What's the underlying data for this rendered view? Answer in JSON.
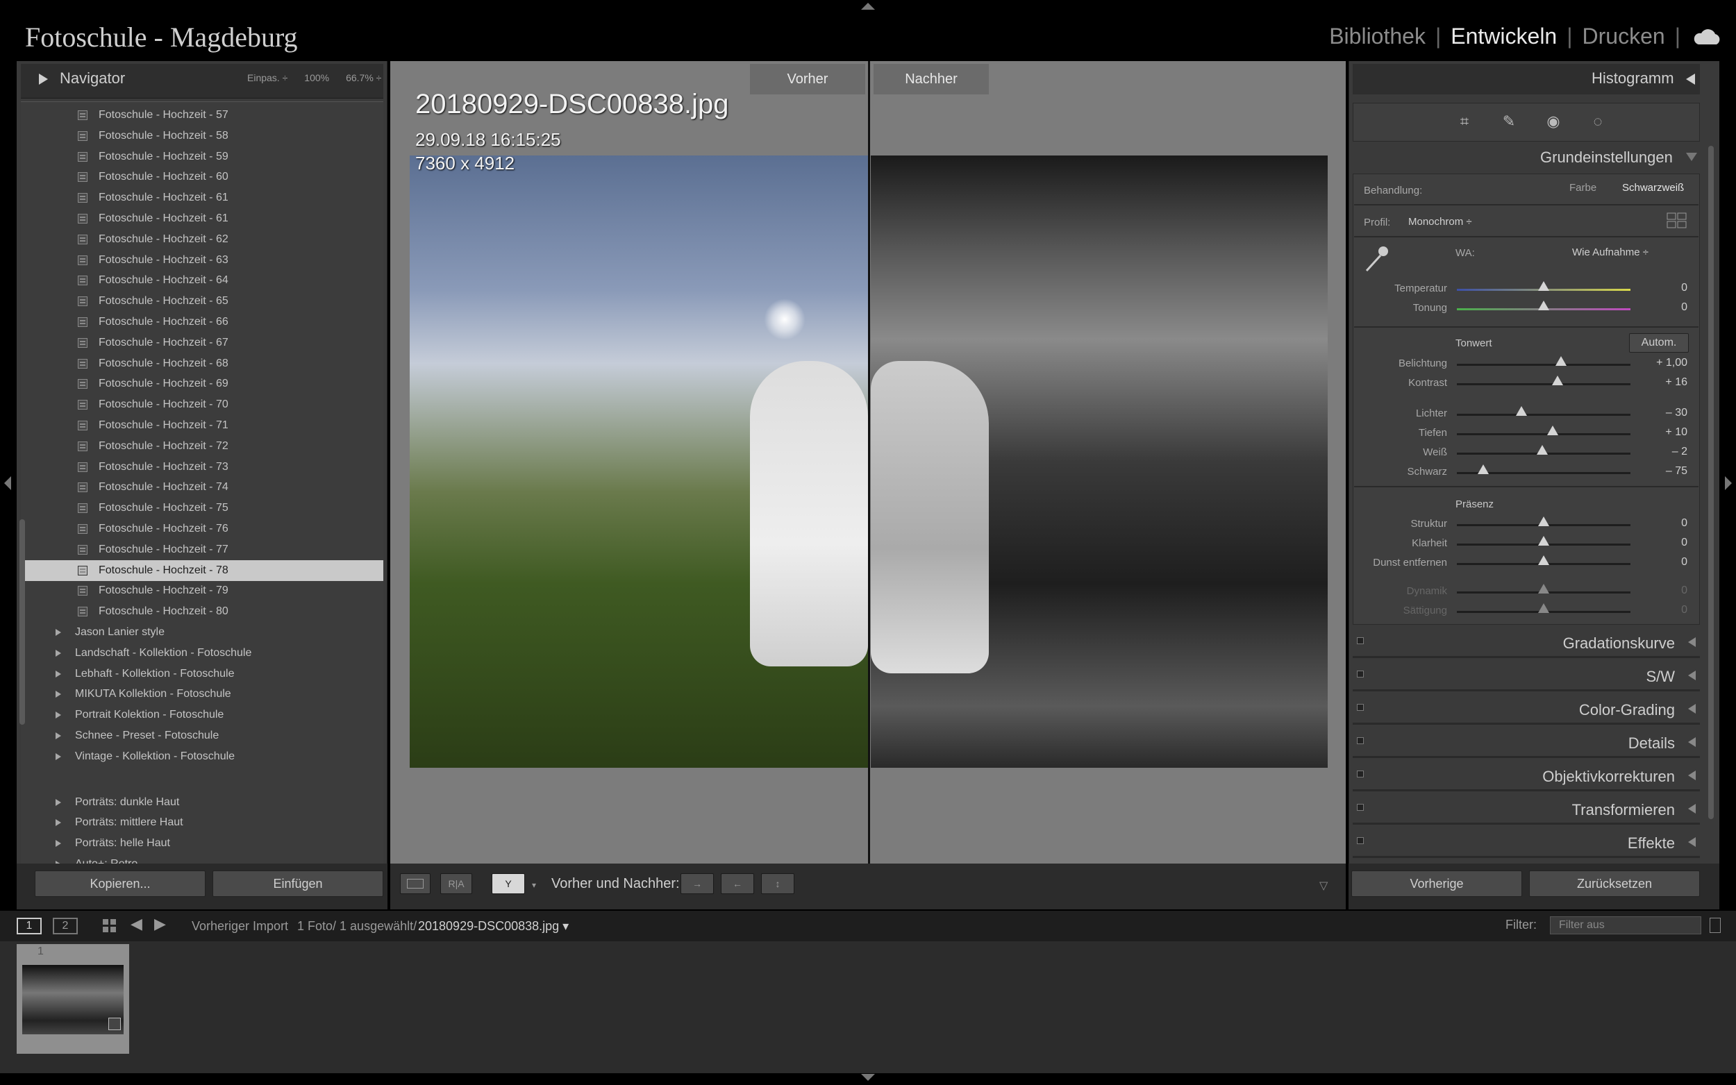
{
  "app": {
    "title": "Fotoschule - Magdeburg"
  },
  "modules": {
    "library": "Bibliothek",
    "develop": "Entwickeln",
    "print": "Drucken",
    "sep": "|"
  },
  "navigator": {
    "title": "Navigator",
    "fit": "Einpas. ÷",
    "zoom100": "100%",
    "zoom667": "66.7% ÷"
  },
  "presets": {
    "items": [
      "Fotoschule - Hochzeit - 57",
      "Fotoschule - Hochzeit - 58",
      "Fotoschule - Hochzeit - 59",
      "Fotoschule - Hochzeit - 60",
      "Fotoschule - Hochzeit - 61",
      "Fotoschule - Hochzeit - 61",
      "Fotoschule - Hochzeit - 62",
      "Fotoschule - Hochzeit - 63",
      "Fotoschule - Hochzeit - 64",
      "Fotoschule - Hochzeit - 65",
      "Fotoschule - Hochzeit - 66",
      "Fotoschule - Hochzeit - 67",
      "Fotoschule - Hochzeit - 68",
      "Fotoschule - Hochzeit - 69",
      "Fotoschule - Hochzeit - 70",
      "Fotoschule - Hochzeit - 71",
      "Fotoschule - Hochzeit - 72",
      "Fotoschule - Hochzeit - 73",
      "Fotoschule - Hochzeit - 74",
      "Fotoschule - Hochzeit - 75",
      "Fotoschule - Hochzeit - 76",
      "Fotoschule - Hochzeit - 77",
      "Fotoschule - Hochzeit - 78",
      "Fotoschule - Hochzeit - 79",
      "Fotoschule - Hochzeit - 80"
    ],
    "folders": [
      "Jason Lanier style",
      "Landschaft - Kollektion - Fotoschule",
      "Lebhaft - Kollektion - Fotoschule",
      "MIKUTA Kollektion - Fotoschule",
      "Portrait Kolektion - Fotoschule",
      "Schnee - Preset - Fotoschule",
      "Vintage - Kollektion - Fotoschule"
    ],
    "folders2": [
      "Porträts: dunkle Haut",
      "Porträts: mittlere Haut",
      "Porträts: helle Haut",
      "Auto+: Retro"
    ]
  },
  "left_buttons": {
    "copy": "Kopieren...",
    "paste": "Einfügen"
  },
  "view": {
    "before_tab": "Vorher",
    "after_tab": "Nachher",
    "filename": "20180929-DSC00838.jpg",
    "datetime": "29.09.18 16:15:25",
    "dimensions": "7360 x 4912"
  },
  "toolbar": {
    "ba_label": "Vorher und Nachher:",
    "ra": "R|A"
  },
  "right": {
    "histogram": "Histogramm",
    "basic": "Grundeinstellungen",
    "treatment_label": "Behandlung:",
    "color": "Farbe",
    "bw": "Schwarzweiß",
    "profile_label": "Profil:",
    "profile_value": "Monochrom ÷",
    "wb_label": "WA:",
    "wb_value": "Wie Aufnahme ÷",
    "tone_label": "Tonwert",
    "auto": "Autom.",
    "presence_label": "Präsenz",
    "sliders": [
      {
        "name": "Temperatur",
        "value": "0",
        "pos": 0.5
      },
      {
        "name": "Tonung",
        "value": "0",
        "pos": 0.5
      },
      {
        "name": "Belichtung",
        "value": "+ 1,00",
        "pos": 0.6
      },
      {
        "name": "Kontrast",
        "value": "+ 16",
        "pos": 0.58
      },
      {
        "name": "Lichter",
        "value": "– 30",
        "pos": 0.37
      },
      {
        "name": "Tiefen",
        "value": "+ 10",
        "pos": 0.55
      },
      {
        "name": "Weiß",
        "value": "– 2",
        "pos": 0.49
      },
      {
        "name": "Schwarz",
        "value": "– 75",
        "pos": 0.15
      },
      {
        "name": "Struktur",
        "value": "0",
        "pos": 0.5
      },
      {
        "name": "Klarheit",
        "value": "0",
        "pos": 0.5
      },
      {
        "name": "Dunst entfernen",
        "value": "0",
        "pos": 0.5
      },
      {
        "name": "Dynamik",
        "value": "0",
        "pos": 0.5
      },
      {
        "name": "Sättigung",
        "value": "0",
        "pos": 0.5
      }
    ],
    "panels": [
      "Gradationskurve",
      "S/W",
      "Color-Grading",
      "Details",
      "Objektivkorrekturen",
      "Transformieren",
      "Effekte"
    ],
    "prev_button": "Vorherige",
    "reset_button": "Zurücksetzen"
  },
  "filmstrip": {
    "page1": "1",
    "page2": "2",
    "source": "Vorheriger Import",
    "count": "1 Foto/ 1 ausgewählt/",
    "file": "20180929-DSC00838.jpg ▾",
    "filter_label": "Filter:",
    "filter_value": "Filter aus",
    "thumb_number": "1"
  }
}
